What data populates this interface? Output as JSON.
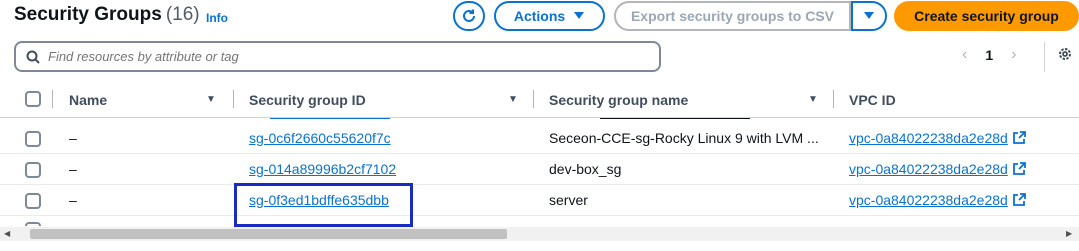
{
  "header": {
    "title": "Security Groups",
    "count": "(16)",
    "info": "Info",
    "actions_label": "Actions",
    "export_label": "Export security groups to CSV",
    "create_label": "Create security group"
  },
  "search": {
    "placeholder": "Find resources by attribute or tag"
  },
  "pagination": {
    "current_page": "1"
  },
  "columns": {
    "name": "Name",
    "sg_id": "Security group ID",
    "sg_name": "Security group name",
    "vpc_id": "VPC ID"
  },
  "rows": [
    {
      "name": "–",
      "sg_id": "sg-0c6f2660c55620f7c",
      "sg_name": "Seceon-CCE-sg-Rocky Linux 9 with LVM ...",
      "vpc_id": "vpc-0a84022238da2e28d"
    },
    {
      "name": "–",
      "sg_id": "sg-014a89996b2cf7102",
      "sg_name": "dev-box_sg",
      "vpc_id": "vpc-0a84022238da2e28d"
    },
    {
      "name": "–",
      "sg_id": "sg-0f3ed1bdffe635dbb",
      "sg_name": "server",
      "vpc_id": "vpc-0a84022238da2e28d"
    }
  ],
  "colors": {
    "primary": "#0972d3",
    "create_button": "#ff9900",
    "highlight_box": "#1a2bbf"
  }
}
